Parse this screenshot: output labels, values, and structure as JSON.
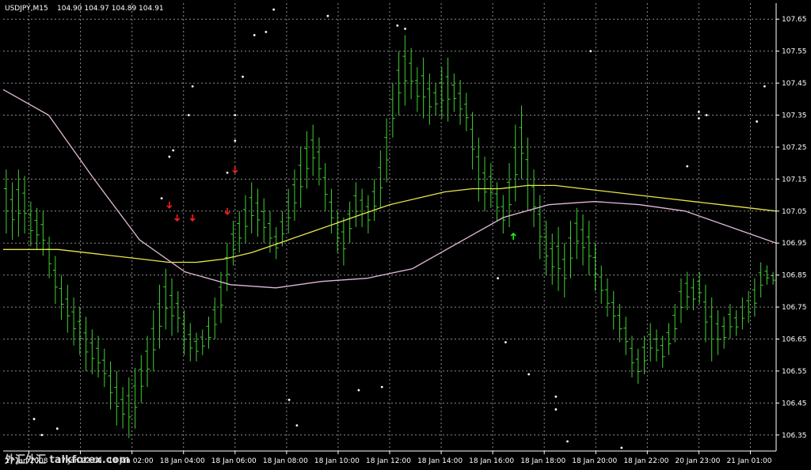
{
  "header": {
    "symbol": "USDJPY,M15",
    "ohlc": "104.90 104.97 104.89 104.91"
  },
  "watermark": "外汇外汇 talkforex.com",
  "colors": {
    "background": "#000000",
    "grid": "#8c8c8c",
    "candle": "#3fcf2f",
    "ma_slow": "#e6e64a",
    "ma_fast": "#e0b8d8",
    "down_arrow": "#ff2020",
    "up_arrow": "#20ff20",
    "fractal": "#ffffff"
  },
  "chart_data": {
    "type": "line",
    "price_axis": {
      "min": 106.3,
      "max": 107.7,
      "ticks": [
        "107.65",
        "107.55",
        "107.45",
        "107.35",
        "107.25",
        "107.15",
        "107.05",
        "106.95",
        "106.85",
        "106.75",
        "106.65",
        "106.55",
        "106.45",
        "106.35"
      ]
    },
    "time_axis": {
      "ticks": [
        "17 Jan 2008",
        "17 Jan 22:00",
        "18 Jan 02:00",
        "18 Jan 04:00",
        "18 Jan 06:00",
        "18 Jan 08:00",
        "18 Jan 10:00",
        "18 Jan 12:00",
        "18 Jan 14:00",
        "18 Jan 16:00",
        "18 Jan 18:00",
        "18 Jan 20:00",
        "18 Jan 22:00",
        "20 Jan 23:00",
        "21 Jan 01:00"
      ]
    },
    "bars": [
      {
        "high": 107.18,
        "low": 106.98
      },
      {
        "high": 107.14,
        "low": 106.96
      },
      {
        "high": 107.18,
        "low": 106.97
      },
      {
        "high": 107.16,
        "low": 106.98
      },
      {
        "high": 107.08,
        "low": 106.94
      },
      {
        "high": 107.06,
        "low": 106.93
      },
      {
        "high": 107.05,
        "low": 106.91
      },
      {
        "high": 106.97,
        "low": 106.84
      },
      {
        "high": 106.91,
        "low": 106.76
      },
      {
        "high": 106.85,
        "low": 106.71
      },
      {
        "high": 106.82,
        "low": 106.67
      },
      {
        "high": 106.78,
        "low": 106.63
      },
      {
        "high": 106.75,
        "low": 106.6
      },
      {
        "high": 106.72,
        "low": 106.55
      },
      {
        "high": 106.68,
        "low": 106.54
      },
      {
        "high": 106.66,
        "low": 106.53
      },
      {
        "high": 106.62,
        "low": 106.5
      },
      {
        "high": 106.58,
        "low": 106.43
      },
      {
        "high": 106.55,
        "low": 106.38
      },
      {
        "high": 106.5,
        "low": 106.37
      },
      {
        "high": 106.53,
        "low": 106.34
      },
      {
        "high": 106.56,
        "low": 106.37
      },
      {
        "high": 106.6,
        "low": 106.45
      },
      {
        "high": 106.66,
        "low": 106.5
      },
      {
        "high": 106.74,
        "low": 106.55
      },
      {
        "high": 106.82,
        "low": 106.62
      },
      {
        "high": 106.87,
        "low": 106.68
      },
      {
        "high": 106.84,
        "low": 106.66
      },
      {
        "high": 106.8,
        "low": 106.67
      },
      {
        "high": 106.74,
        "low": 106.6
      },
      {
        "high": 106.7,
        "low": 106.58
      },
      {
        "high": 106.67,
        "low": 106.58
      },
      {
        "high": 106.68,
        "low": 106.6
      },
      {
        "high": 106.72,
        "low": 106.62
      },
      {
        "high": 106.78,
        "low": 106.65
      },
      {
        "high": 106.86,
        "low": 106.7
      },
      {
        "high": 106.95,
        "low": 106.8
      },
      {
        "high": 107.02,
        "low": 106.88
      },
      {
        "high": 107.05,
        "low": 106.92
      },
      {
        "high": 107.1,
        "low": 106.95
      },
      {
        "high": 107.14,
        "low": 106.98
      },
      {
        "high": 107.12,
        "low": 106.97
      },
      {
        "high": 107.09,
        "low": 106.95
      },
      {
        "high": 107.05,
        "low": 106.92
      },
      {
        "high": 107.0,
        "low": 106.9
      },
      {
        "high": 107.05,
        "low": 106.94
      },
      {
        "high": 107.12,
        "low": 106.98
      },
      {
        "high": 107.18,
        "low": 107.02
      },
      {
        "high": 107.25,
        "low": 107.06
      },
      {
        "high": 107.3,
        "low": 107.12
      },
      {
        "high": 107.32,
        "low": 107.16
      },
      {
        "high": 107.28,
        "low": 107.13
      },
      {
        "high": 107.2,
        "low": 107.05
      },
      {
        "high": 107.12,
        "low": 106.98
      },
      {
        "high": 107.05,
        "low": 106.92
      },
      {
        "high": 107.03,
        "low": 106.88
      },
      {
        "high": 107.08,
        "low": 106.95
      },
      {
        "high": 107.14,
        "low": 107.0
      },
      {
        "high": 107.12,
        "low": 107.0
      },
      {
        "high": 107.1,
        "low": 106.98
      },
      {
        "high": 107.15,
        "low": 107.02
      },
      {
        "high": 107.24,
        "low": 107.06
      },
      {
        "high": 107.34,
        "low": 107.14
      },
      {
        "high": 107.45,
        "low": 107.28
      },
      {
        "high": 107.55,
        "low": 107.35
      },
      {
        "high": 107.6,
        "low": 107.38
      },
      {
        "high": 107.56,
        "low": 107.4
      },
      {
        "high": 107.5,
        "low": 107.36
      },
      {
        "high": 107.53,
        "low": 107.34
      },
      {
        "high": 107.48,
        "low": 107.32
      },
      {
        "high": 107.45,
        "low": 107.35
      },
      {
        "high": 107.5,
        "low": 107.34
      },
      {
        "high": 107.53,
        "low": 107.33
      },
      {
        "high": 107.48,
        "low": 107.36
      },
      {
        "high": 107.46,
        "low": 107.32
      },
      {
        "high": 107.42,
        "low": 107.3
      },
      {
        "high": 107.36,
        "low": 107.18
      },
      {
        "high": 107.28,
        "low": 107.08
      },
      {
        "high": 107.22,
        "low": 107.05
      },
      {
        "high": 107.2,
        "low": 107.06
      },
      {
        "high": 107.14,
        "low": 107.02
      },
      {
        "high": 107.1,
        "low": 106.98
      },
      {
        "high": 107.2,
        "low": 107.0
      },
      {
        "high": 107.32,
        "low": 107.08
      },
      {
        "high": 107.38,
        "low": 107.15
      },
      {
        "high": 107.28,
        "low": 107.05
      },
      {
        "high": 107.18,
        "low": 107.0
      },
      {
        "high": 107.1,
        "low": 106.9
      },
      {
        "high": 107.02,
        "low": 106.85
      },
      {
        "high": 106.98,
        "low": 106.82
      },
      {
        "high": 107.0,
        "low": 106.8
      },
      {
        "high": 106.95,
        "low": 106.78
      },
      {
        "high": 107.02,
        "low": 106.84
      },
      {
        "high": 107.06,
        "low": 106.9
      },
      {
        "high": 107.04,
        "low": 106.88
      },
      {
        "high": 107.02,
        "low": 106.85
      },
      {
        "high": 106.95,
        "low": 106.8
      },
      {
        "high": 106.88,
        "low": 106.76
      },
      {
        "high": 106.84,
        "low": 106.72
      },
      {
        "high": 106.8,
        "low": 106.68
      },
      {
        "high": 106.76,
        "low": 106.64
      },
      {
        "high": 106.72,
        "low": 106.6
      },
      {
        "high": 106.66,
        "low": 106.53
      },
      {
        "high": 106.62,
        "low": 106.51
      },
      {
        "high": 106.66,
        "low": 106.54
      },
      {
        "high": 106.7,
        "low": 106.58
      },
      {
        "high": 106.68,
        "low": 106.58
      },
      {
        "high": 106.66,
        "low": 106.56
      },
      {
        "high": 106.7,
        "low": 106.6
      },
      {
        "high": 106.76,
        "low": 106.64
      },
      {
        "high": 106.84,
        "low": 106.7
      },
      {
        "high": 106.86,
        "low": 106.74
      },
      {
        "high": 106.84,
        "low": 106.74
      },
      {
        "high": 106.86,
        "low": 106.76
      },
      {
        "high": 106.82,
        "low": 106.64
      },
      {
        "high": 106.78,
        "low": 106.58
      },
      {
        "high": 106.74,
        "low": 106.6
      },
      {
        "high": 106.72,
        "low": 106.62
      },
      {
        "high": 106.76,
        "low": 106.65
      },
      {
        "high": 106.74,
        "low": 106.66
      },
      {
        "high": 106.78,
        "low": 106.68
      },
      {
        "high": 106.8,
        "low": 106.7
      },
      {
        "high": 106.84,
        "low": 106.72
      },
      {
        "high": 106.89,
        "low": 106.78
      },
      {
        "high": 106.88,
        "low": 106.82
      },
      {
        "high": 106.86,
        "low": 106.82
      }
    ],
    "series": [
      {
        "values": [
          106.93,
          106.93,
          106.93,
          106.92,
          106.91,
          106.9,
          106.89,
          106.89,
          106.9,
          106.92,
          106.95,
          106.98,
          107.01,
          107.04,
          107.07,
          107.09,
          107.11,
          107.12,
          107.12,
          107.13,
          107.13,
          107.12,
          107.11,
          107.1,
          107.09,
          107.08,
          107.07,
          107.06,
          107.05
        ]
      },
      {
        "values": [
          107.43,
          107.35,
          107.15,
          106.96,
          106.86,
          106.82,
          106.81,
          106.83,
          106.84,
          106.87,
          106.95,
          107.03,
          107.07,
          107.08,
          107.07,
          107.05,
          107.0,
          106.95
        ]
      }
    ],
    "arrows_down": [
      107.06,
      107.02,
      107.02,
      107.04,
      107.17
    ],
    "arrows_up": [
      106.98
    ],
    "fractals": [
      107.68,
      107.66,
      107.63,
      107.62,
      107.61,
      107.6,
      107.55,
      107.47,
      107.44,
      107.35,
      107.35,
      107.34,
      107.27,
      107.24,
      107.22,
      107.17,
      107.09,
      106.84,
      106.64,
      106.54,
      106.5,
      106.49,
      106.47,
      106.4,
      106.38,
      106.35,
      106.33,
      106.31,
      106.37,
      106.46,
      106.43,
      107.19,
      107.36,
      107.35,
      107.33,
      107.44
    ]
  }
}
